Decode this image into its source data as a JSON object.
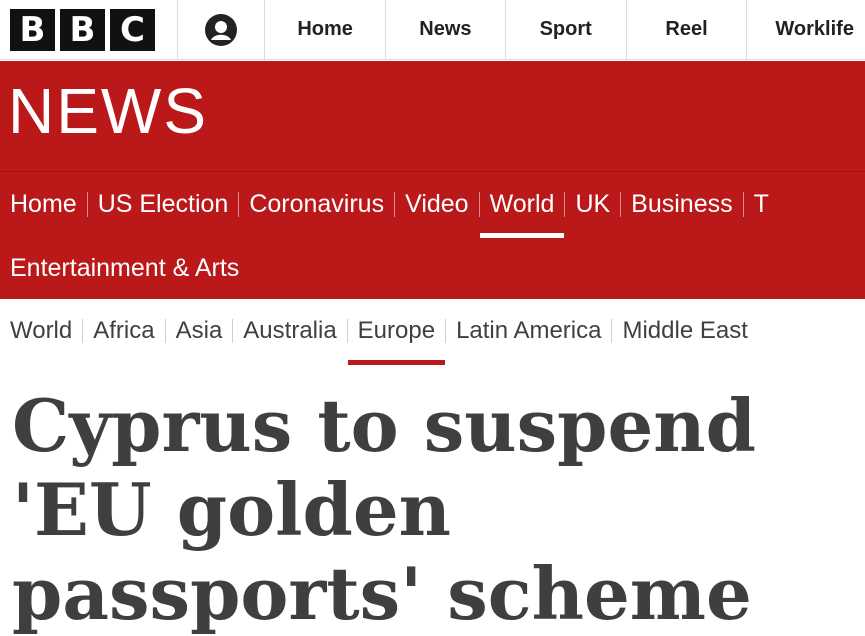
{
  "topbar": {
    "logo_letters": [
      "B",
      "B",
      "C"
    ],
    "items": [
      {
        "label": "Home"
      },
      {
        "label": "News"
      },
      {
        "label": "Sport"
      },
      {
        "label": "Reel"
      },
      {
        "label": "Worklife"
      }
    ]
  },
  "masthead": {
    "brand": "NEWS",
    "nav_row1": [
      {
        "label": "Home"
      },
      {
        "label": "US Election"
      },
      {
        "label": "Coronavirus"
      },
      {
        "label": "Video"
      },
      {
        "label": "World"
      },
      {
        "label": "UK"
      },
      {
        "label": "Business"
      },
      {
        "label": "T"
      }
    ],
    "nav_row2": [
      {
        "label": "Entertainment & Arts"
      }
    ]
  },
  "subnav": {
    "items": [
      {
        "label": "World"
      },
      {
        "label": "Africa"
      },
      {
        "label": "Asia"
      },
      {
        "label": "Australia"
      },
      {
        "label": "Europe"
      },
      {
        "label": "Latin America"
      },
      {
        "label": "Middle East"
      }
    ]
  },
  "article": {
    "headline": "Cyprus to suspend 'EU golden passports' scheme"
  },
  "colors": {
    "brand_red": "#bb1919",
    "text_dark": "#3f3f42"
  }
}
